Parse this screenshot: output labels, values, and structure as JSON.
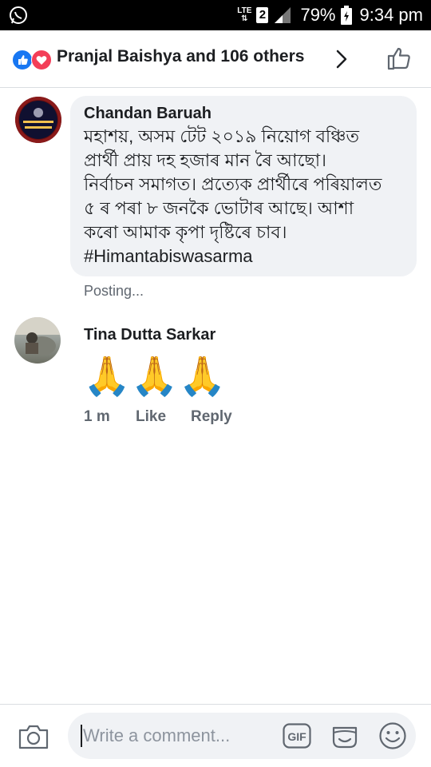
{
  "status_bar": {
    "network": "LTE",
    "sim": "2",
    "battery": "79%",
    "time": "9:34 pm"
  },
  "header": {
    "title": "Pranjal Baishya and 106 others"
  },
  "comments": [
    {
      "author": "Chandan Baruah",
      "lines": [
        "মহাশয়, অসম টেট ২০১৯ নিয়োগ বঞ্চিত",
        "প্ৰাৰ্থী প্ৰায় দহ হজাৰ মান ৰৈ আছো।",
        "নিৰ্বাচন সমাগত। প্ৰত্যেক প্ৰাৰ্থীৰে পৰিয়ালত",
        "৫ ৰ পৰা ৮ জনকৈ ভোটাৰ আছে। আশা",
        "কৰো আমাক কৃপা দৃষ্টিৰে চাব।",
        "#Himantabiswasarma"
      ],
      "status": "Posting..."
    },
    {
      "author": "Tina Dutta Sarkar",
      "text": "🙏🙏🙏",
      "time": "1 m",
      "like_label": "Like",
      "reply_label": "Reply"
    }
  ],
  "composer": {
    "placeholder": "Write a comment...",
    "gif_label": "GIF"
  },
  "colors": {
    "like_blue": "#1877f2",
    "love_red": "#f33e58",
    "bubble_bg": "#f0f2f5",
    "meta_gray": "#606770"
  }
}
